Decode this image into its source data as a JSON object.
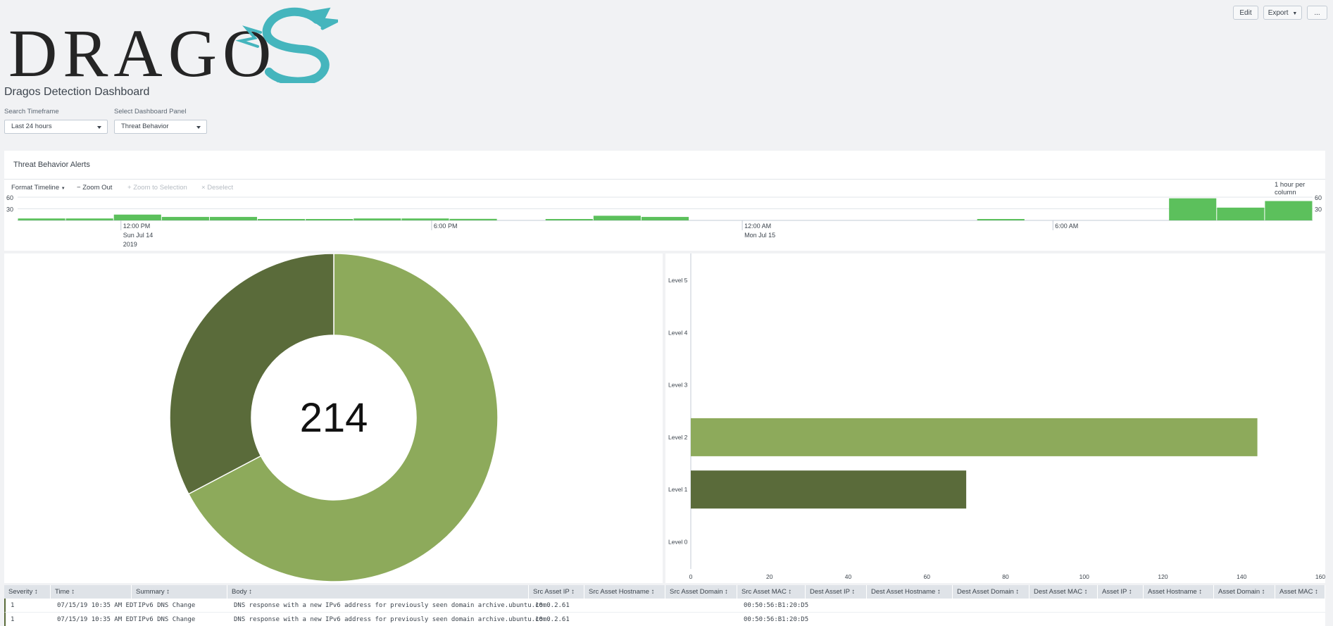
{
  "toolbar": {
    "edit_label": "Edit",
    "export_label": "Export",
    "more_label": "..."
  },
  "logo": {
    "text": "DRAGOS"
  },
  "page_title": "Dragos Detection Dashboard",
  "filters": {
    "timeframe_label": "Search Timeframe",
    "timeframe_value": "Last 24 hours",
    "panel_label": "Select Dashboard Panel",
    "panel_value": "Threat Behavior"
  },
  "alerts_panel": {
    "title": "Threat Behavior Alerts",
    "format_timeline": "Format Timeline",
    "zoom_out": "Zoom Out",
    "zoom_selection": "Zoom to Selection",
    "deselect": "Deselect",
    "resolution": "1 hour per column"
  },
  "colors": {
    "timeline_bar": "#5cc05c",
    "level2": "#8daa5b",
    "level1": "#5a6b3a"
  },
  "chart_data": [
    {
      "type": "bar",
      "name_hint": "timeline",
      "x_ticks": [
        {
          "line1": "12:00 PM",
          "line2": "Sun Jul 14",
          "line3": "2019"
        },
        {
          "line1": "6:00 PM",
          "line2": "",
          "line3": ""
        },
        {
          "line1": "12:00 AM",
          "line2": "Mon Jul 15",
          "line3": ""
        },
        {
          "line1": "6:00 AM",
          "line2": "",
          "line3": ""
        }
      ],
      "y_ticks": [
        "60",
        "30"
      ],
      "ylim": [
        0,
        60
      ],
      "values": [
        5,
        5,
        15,
        9,
        9,
        3,
        3,
        5,
        5,
        4,
        0,
        3,
        12,
        9,
        0,
        0,
        0,
        0,
        0,
        0,
        2,
        0,
        0,
        0,
        57,
        33,
        50
      ]
    },
    {
      "type": "pie",
      "center_label": "214",
      "slices": [
        {
          "label": "Level 2",
          "value": 144
        },
        {
          "label": "Level 1",
          "value": 70
        }
      ]
    },
    {
      "type": "bar",
      "orientation": "horizontal",
      "categories": [
        "Level 5",
        "Level 4",
        "Level 3",
        "Level 2",
        "Level 1",
        "Level 0"
      ],
      "values": [
        0,
        0,
        0,
        144,
        70,
        0
      ],
      "x_ticks": [
        "0",
        "20",
        "40",
        "60",
        "80",
        "100",
        "120",
        "140",
        "160"
      ],
      "xlim": [
        0,
        160
      ]
    }
  ],
  "table": {
    "columns": [
      "Severity",
      "Time",
      "Summary",
      "Body",
      "Src Asset IP",
      "Src Asset Hostname",
      "Src Asset Domain",
      "Src Asset MAC",
      "Dest Asset IP",
      "Dest Asset Hostname",
      "Dest Asset Domain",
      "Dest Asset MAC",
      "Asset IP",
      "Asset Hostname",
      "Asset Domain",
      "Asset MAC"
    ],
    "rows": [
      {
        "severity": "1",
        "time": "07/15/19 10:35 AM EDT",
        "summary": "IPv6 DNS Change",
        "body": "DNS response with a new IPv6 address for previously seen domain archive.ubuntu.com.",
        "src_ip": "10.0.2.61",
        "src_mac": "00:50:56:B1:20:D5"
      },
      {
        "severity": "1",
        "time": "07/15/19 10:35 AM EDT",
        "summary": "IPv6 DNS Change",
        "body": "DNS response with a new IPv6 address for previously seen domain archive.ubuntu.com.",
        "src_ip": "10.0.2.61",
        "src_mac": "00:50:56:B1:20:D5"
      }
    ]
  }
}
